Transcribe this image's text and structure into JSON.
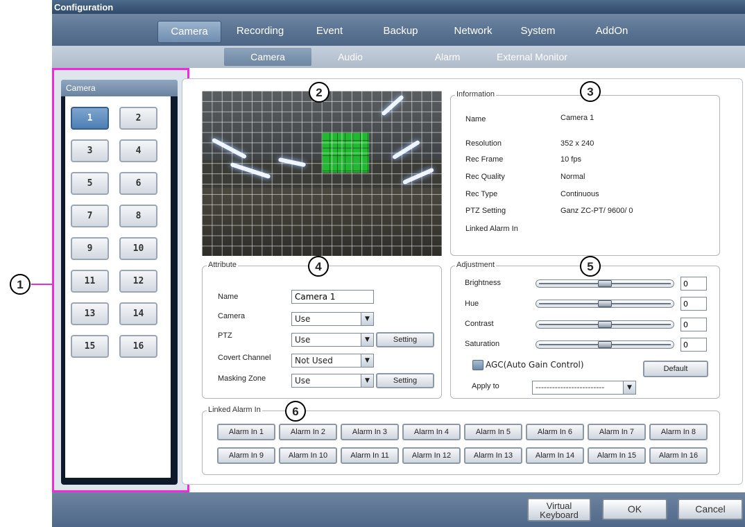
{
  "window": {
    "title": "Configuration"
  },
  "main_tabs": [
    {
      "label": "Camera",
      "active": true
    },
    {
      "label": "Recording"
    },
    {
      "label": "Event"
    },
    {
      "label": "Backup"
    },
    {
      "label": "Network"
    },
    {
      "label": "System"
    },
    {
      "label": "AddOn"
    }
  ],
  "sub_tabs": [
    {
      "label": "Camera",
      "active": true
    },
    {
      "label": "Audio"
    },
    {
      "label": "Alarm"
    },
    {
      "label": "External Monitor"
    }
  ],
  "camera_panel": {
    "header": "Camera",
    "buttons": [
      "1",
      "2",
      "3",
      "4",
      "5",
      "6",
      "7",
      "8",
      "9",
      "10",
      "11",
      "12",
      "13",
      "14",
      "15",
      "16"
    ],
    "selected": "1"
  },
  "callouts": [
    "1",
    "2",
    "3",
    "4",
    "5",
    "6"
  ],
  "information": {
    "legend": "Information",
    "rows": [
      {
        "label": "Name",
        "value": "Camera 1"
      },
      {
        "label": "Resolution",
        "value": "352 x 240"
      },
      {
        "label": "Rec Frame",
        "value": "10 fps"
      },
      {
        "label": "Rec Quality",
        "value": "Normal"
      },
      {
        "label": "Rec Type",
        "value": "Continuous"
      },
      {
        "label": "PTZ Setting",
        "value": "Ganz ZC-PT/ 9600/ 0"
      },
      {
        "label": "Linked Alarm In",
        "value": ""
      }
    ]
  },
  "attribute": {
    "legend": "Attribute",
    "name_label": "Name",
    "name_value": "Camera 1",
    "camera_label": "Camera",
    "camera_value": "Use",
    "ptz_label": "PTZ",
    "ptz_value": "Use",
    "ptz_setting": "Setting",
    "covert_label": "Covert Channel",
    "covert_value": "Not Used",
    "masking_label": "Masking Zone",
    "masking_value": "Use",
    "masking_setting": "Setting"
  },
  "adjustment": {
    "legend": "Adjustment",
    "sliders": [
      {
        "label": "Brightness",
        "value": "0",
        "level": 0.5
      },
      {
        "label": "Hue",
        "value": "0",
        "level": 0.5
      },
      {
        "label": "Contrast",
        "value": "0",
        "level": 0.5
      },
      {
        "label": "Saturation",
        "value": "0",
        "level": 0.5
      }
    ],
    "agc_label": "AGC(Auto Gain Control)",
    "agc_checked": false,
    "default_label": "Default",
    "apply_label": "Apply to",
    "apply_value": "-------------------------"
  },
  "linked_alarm": {
    "legend": "Linked Alarm In",
    "buttons": [
      "Alarm In 1",
      "Alarm In 2",
      "Alarm In 3",
      "Alarm In 4",
      "Alarm In 5",
      "Alarm In 6",
      "Alarm In 7",
      "Alarm In 8",
      "Alarm In 9",
      "Alarm In 10",
      "Alarm In 11",
      "Alarm In 12",
      "Alarm In 13",
      "Alarm In 14",
      "Alarm In 15",
      "Alarm In 16"
    ]
  },
  "footer": {
    "virtual_keyboard": "Virtual Keyboard",
    "ok": "OK",
    "cancel": "Cancel"
  },
  "colors": {
    "highlight": "#ee2bdc",
    "mask_zone": "#23b832",
    "selected_camera": "#4d7fb3"
  }
}
